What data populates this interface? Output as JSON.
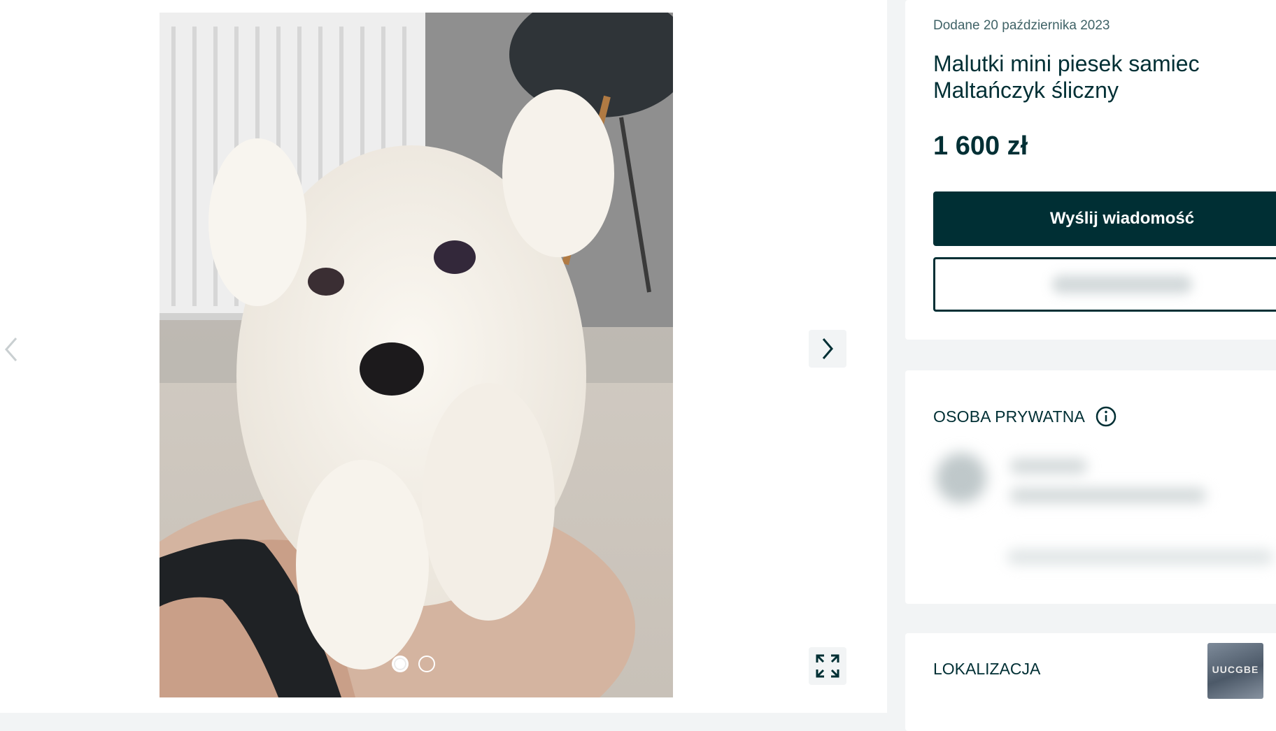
{
  "gallery": {
    "photo_alt": "Malutki mini piesek samiec Maltańczyk śliczny",
    "current_index": 1,
    "total_images": 2
  },
  "listing": {
    "posted": "Dodane 20 października 2023",
    "title": "Malutki mini piesek samiec Maltańczyk śliczny",
    "price": "1 600 zł",
    "primary_button": "Wyślij wiadomość"
  },
  "seller": {
    "heading": "OSOBA PRYWATNA"
  },
  "location": {
    "heading": "LOKALIZACJA"
  },
  "thumbnail": {
    "label": "UUCGBE"
  },
  "colors": {
    "brand_dark": "#002f34",
    "background": "#f2f4f5"
  }
}
